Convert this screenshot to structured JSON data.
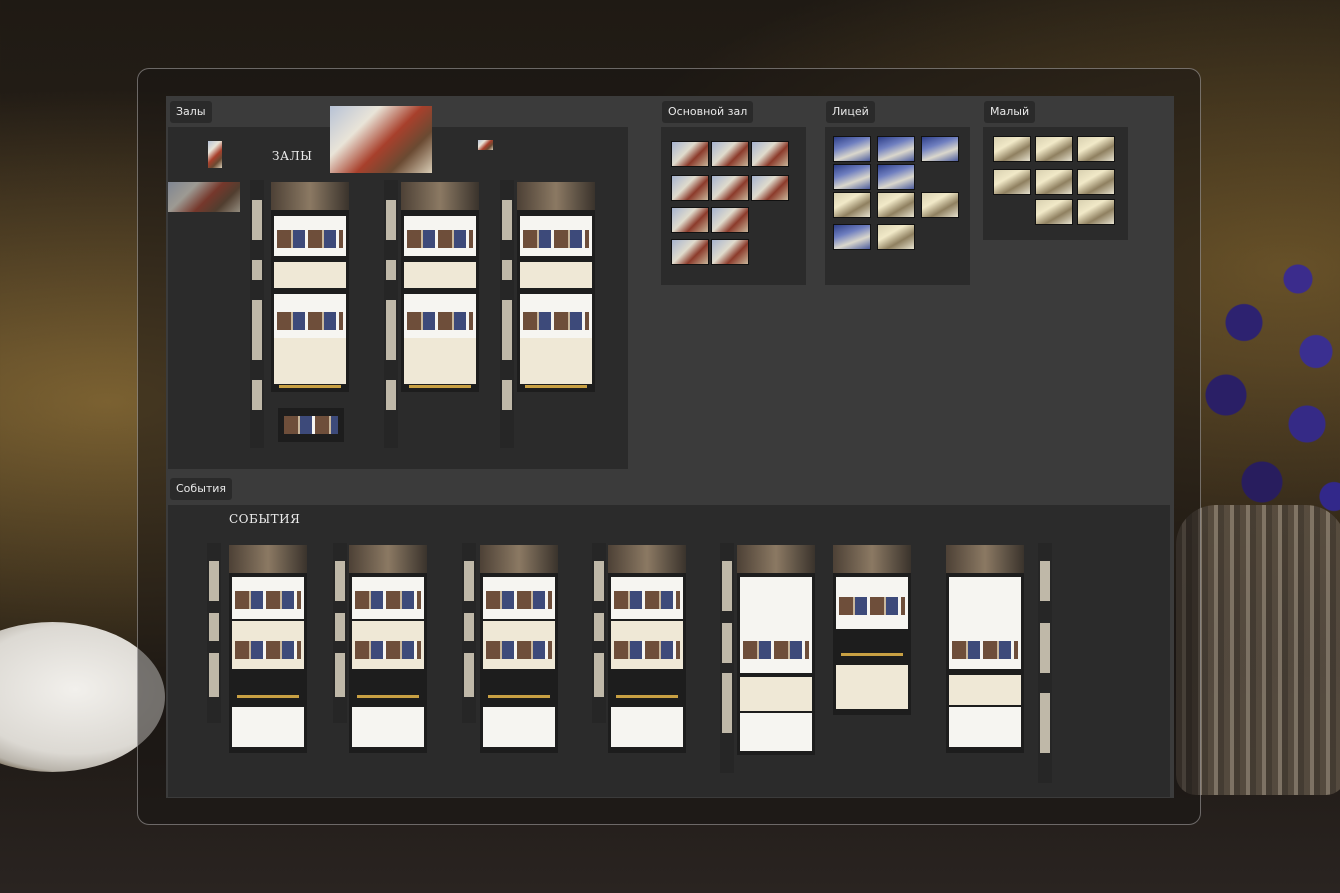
{
  "sections": {
    "halls": {
      "label": "Залы",
      "heading": "ЗАЛЫ"
    },
    "main_hall": {
      "label": "Основной зал"
    },
    "lyceum": {
      "label": "Лицей"
    },
    "small": {
      "label": "Малый"
    },
    "events": {
      "label": "События",
      "heading": "СОБЫТИЯ"
    }
  }
}
